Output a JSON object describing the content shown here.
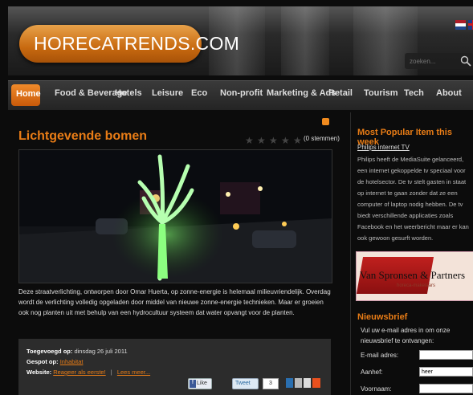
{
  "header": {
    "logo_text": "HORECATRENDS.COM",
    "search_placeholder": "zoeken..."
  },
  "nav": [
    {
      "label": "Home",
      "active": true
    },
    {
      "label": "Food & Beverage"
    },
    {
      "label": "Hotels"
    },
    {
      "label": "Leisure"
    },
    {
      "label": "Eco"
    },
    {
      "label": "Non-profit"
    },
    {
      "label": "Marketing & Ads"
    },
    {
      "label": "Retail"
    },
    {
      "label": "Tourism"
    },
    {
      "label": "Tech"
    },
    {
      "label": "About"
    }
  ],
  "article": {
    "title": "Lichtgevende bomen",
    "votes": "(0 stemmen)",
    "body": "Deze straatverlichting, ontworpen door Omar Huerta, op zonne-energie is helemaal milieuvriendelijk. Overdag wordt de verlichting volledig opgeladen door middel van nieuwe zonne-energie technieken. Maar er groeien ook nog planten uit met behulp van een hydrocultuur systeem dat water opvangt voor de planten.",
    "meta": {
      "added_label": "Toegevoegd op:",
      "added_value": "dinsdag 26 juli 2011",
      "spotted_label": "Gespot op:",
      "spotted_value": "Inhabitat",
      "website_label": "Website:",
      "react_link": "Reageer als eerste!",
      "separator": "|",
      "read_more": "Lees meer..."
    },
    "share": {
      "like": "Like",
      "tweet": "Tweet",
      "tweet_count": "3"
    }
  },
  "sidebar": {
    "popular_title": "Most Popular Item this week",
    "popular_link": "Philips internet TV",
    "popular_text": "Philips heeft de MediaSuite gelanceerd, een internet gekoppelde tv speciaal voor de hotelsector. De tv stelt gasten in staat op internet te gaan zonder dat ze een computer of laptop nodig hebben. De tv biedt verschillende applicaties zoals Facebook en het weerbericht maar er kan ook gewoon gesurft worden.",
    "banner_title": "Van Spronsen & Partners",
    "banner_sub": "horeca-makelaars",
    "newsletter_title": "Nieuwsbrief",
    "newsletter_text": "Vul uw e-mail adres in om onze nieuwsbrief te ontvangen:",
    "form": {
      "email_label": "E-mail adres:",
      "salutation_label": "Aanhef:",
      "salutation_value": "heer",
      "firstname_label": "Voornaam:"
    }
  },
  "colors": {
    "accent": "#e87c16",
    "background": "#0c0c0c"
  }
}
